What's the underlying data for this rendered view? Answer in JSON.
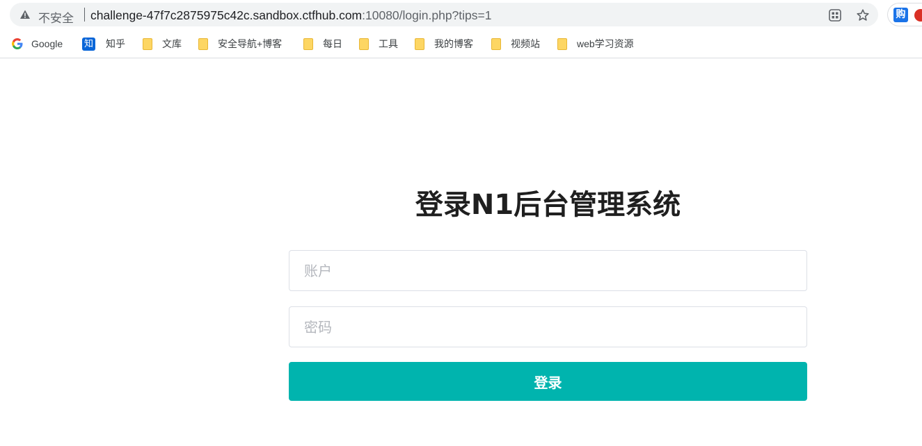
{
  "browser": {
    "security_label": "不安全",
    "url_host": "challenge-47f7c2875975c42c.sandbox.ctfhub.com",
    "url_rest": ":10080/login.php?tips=1",
    "icons": [
      "warning-icon",
      "qr-code-icon",
      "star-icon",
      "extension-gou-icon",
      "extension-red-icon"
    ]
  },
  "bookmarks": [
    {
      "label": "Google",
      "icon": "google-icon"
    },
    {
      "label": "知乎",
      "icon": "zhihu-icon",
      "icon_text": "知"
    },
    {
      "label": "文库",
      "icon": "folder-icon"
    },
    {
      "label": "安全导航+博客",
      "icon": "folder-icon"
    },
    {
      "label": "每日",
      "icon": "folder-icon"
    },
    {
      "label": "工具",
      "icon": "folder-icon"
    },
    {
      "label": "我的博客",
      "icon": "folder-icon"
    },
    {
      "label": "视频站",
      "icon": "folder-icon"
    },
    {
      "label": "web学习资源",
      "icon": "folder-icon"
    }
  ],
  "login": {
    "title": "登录N1后台管理系统",
    "username_placeholder": "账户",
    "password_placeholder": "密码",
    "submit_label": "登录",
    "accent_color": "#00b4ae"
  }
}
